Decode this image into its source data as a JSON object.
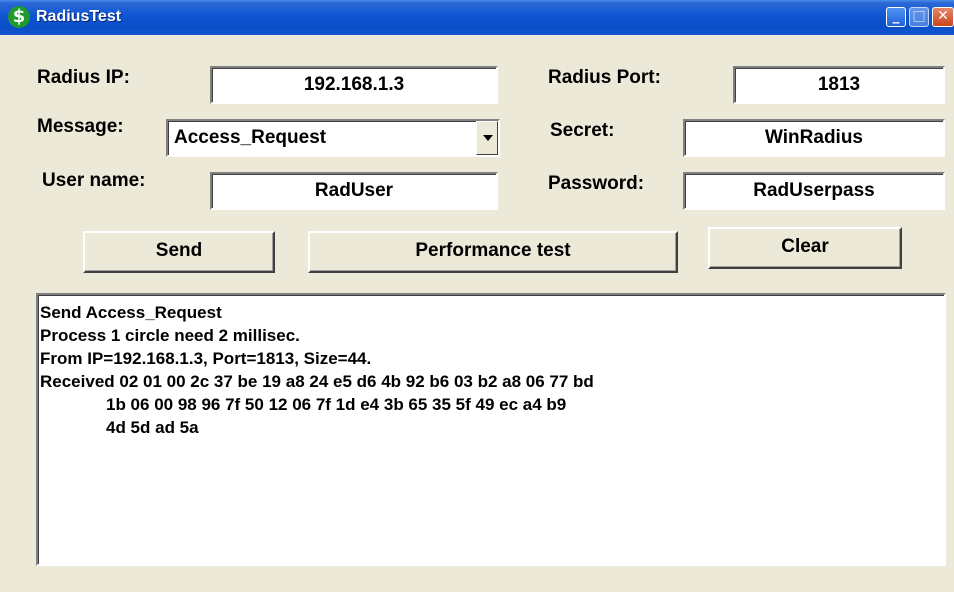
{
  "window": {
    "title": "RadiusTest",
    "app_icon": "dollar-icon",
    "controls": [
      "minimize-icon",
      "maximize-icon",
      "close-icon"
    ]
  },
  "form": {
    "radius_ip_label": "Radius IP:",
    "radius_ip_value": "192.168.1.3",
    "radius_port_label": "Radius Port:",
    "radius_port_value": "1813",
    "message_label": "Message:",
    "message_value": "Access_Request",
    "secret_label": "Secret:",
    "secret_value": "WinRadius",
    "username_label": "User name:",
    "username_value": "RadUser",
    "password_label": "Password:",
    "password_value": "RadUserpass"
  },
  "buttons": {
    "send": "Send",
    "performance_test": "Performance test",
    "clear": "Clear"
  },
  "output": {
    "lines": [
      "Send Access_Request",
      "Process 1 circle need 2 millisec.",
      "From IP=192.168.1.3, Port=1813, Size=44.",
      "Received 02 01 00 2c 37 be 19 a8 24 e5 d6 4b 92 b6 03 b2 a8 06 77 bd",
      "1b 06 00 98 96 7f 50 12 06 7f 1d e4 3b 65 35 5f 49 ec a4 b9",
      "4d 5d ad 5a"
    ]
  },
  "colors": {
    "title_bar": "#0a4ec8",
    "window_bg": "#ece9d8",
    "field_bg": "#ffffff",
    "icon_green": "#1f9a2c"
  }
}
